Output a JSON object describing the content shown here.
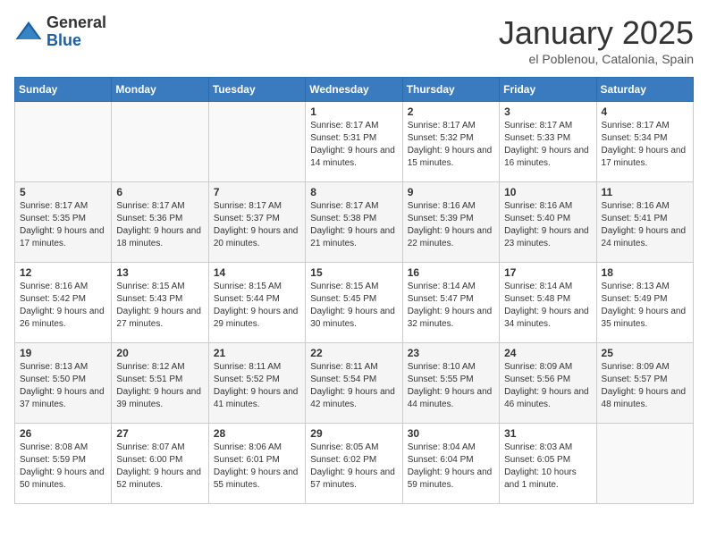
{
  "logo": {
    "general": "General",
    "blue": "Blue"
  },
  "title": "January 2025",
  "subtitle": "el Poblenou, Catalonia, Spain",
  "days_of_week": [
    "Sunday",
    "Monday",
    "Tuesday",
    "Wednesday",
    "Thursday",
    "Friday",
    "Saturday"
  ],
  "weeks": [
    [
      {
        "day": "",
        "sunrise": "",
        "sunset": "",
        "daylight": ""
      },
      {
        "day": "",
        "sunrise": "",
        "sunset": "",
        "daylight": ""
      },
      {
        "day": "",
        "sunrise": "",
        "sunset": "",
        "daylight": ""
      },
      {
        "day": "1",
        "sunrise": "Sunrise: 8:17 AM",
        "sunset": "Sunset: 5:31 PM",
        "daylight": "Daylight: 9 hours and 14 minutes."
      },
      {
        "day": "2",
        "sunrise": "Sunrise: 8:17 AM",
        "sunset": "Sunset: 5:32 PM",
        "daylight": "Daylight: 9 hours and 15 minutes."
      },
      {
        "day": "3",
        "sunrise": "Sunrise: 8:17 AM",
        "sunset": "Sunset: 5:33 PM",
        "daylight": "Daylight: 9 hours and 16 minutes."
      },
      {
        "day": "4",
        "sunrise": "Sunrise: 8:17 AM",
        "sunset": "Sunset: 5:34 PM",
        "daylight": "Daylight: 9 hours and 17 minutes."
      }
    ],
    [
      {
        "day": "5",
        "sunrise": "Sunrise: 8:17 AM",
        "sunset": "Sunset: 5:35 PM",
        "daylight": "Daylight: 9 hours and 17 minutes."
      },
      {
        "day": "6",
        "sunrise": "Sunrise: 8:17 AM",
        "sunset": "Sunset: 5:36 PM",
        "daylight": "Daylight: 9 hours and 18 minutes."
      },
      {
        "day": "7",
        "sunrise": "Sunrise: 8:17 AM",
        "sunset": "Sunset: 5:37 PM",
        "daylight": "Daylight: 9 hours and 20 minutes."
      },
      {
        "day": "8",
        "sunrise": "Sunrise: 8:17 AM",
        "sunset": "Sunset: 5:38 PM",
        "daylight": "Daylight: 9 hours and 21 minutes."
      },
      {
        "day": "9",
        "sunrise": "Sunrise: 8:16 AM",
        "sunset": "Sunset: 5:39 PM",
        "daylight": "Daylight: 9 hours and 22 minutes."
      },
      {
        "day": "10",
        "sunrise": "Sunrise: 8:16 AM",
        "sunset": "Sunset: 5:40 PM",
        "daylight": "Daylight: 9 hours and 23 minutes."
      },
      {
        "day": "11",
        "sunrise": "Sunrise: 8:16 AM",
        "sunset": "Sunset: 5:41 PM",
        "daylight": "Daylight: 9 hours and 24 minutes."
      }
    ],
    [
      {
        "day": "12",
        "sunrise": "Sunrise: 8:16 AM",
        "sunset": "Sunset: 5:42 PM",
        "daylight": "Daylight: 9 hours and 26 minutes."
      },
      {
        "day": "13",
        "sunrise": "Sunrise: 8:15 AM",
        "sunset": "Sunset: 5:43 PM",
        "daylight": "Daylight: 9 hours and 27 minutes."
      },
      {
        "day": "14",
        "sunrise": "Sunrise: 8:15 AM",
        "sunset": "Sunset: 5:44 PM",
        "daylight": "Daylight: 9 hours and 29 minutes."
      },
      {
        "day": "15",
        "sunrise": "Sunrise: 8:15 AM",
        "sunset": "Sunset: 5:45 PM",
        "daylight": "Daylight: 9 hours and 30 minutes."
      },
      {
        "day": "16",
        "sunrise": "Sunrise: 8:14 AM",
        "sunset": "Sunset: 5:47 PM",
        "daylight": "Daylight: 9 hours and 32 minutes."
      },
      {
        "day": "17",
        "sunrise": "Sunrise: 8:14 AM",
        "sunset": "Sunset: 5:48 PM",
        "daylight": "Daylight: 9 hours and 34 minutes."
      },
      {
        "day": "18",
        "sunrise": "Sunrise: 8:13 AM",
        "sunset": "Sunset: 5:49 PM",
        "daylight": "Daylight: 9 hours and 35 minutes."
      }
    ],
    [
      {
        "day": "19",
        "sunrise": "Sunrise: 8:13 AM",
        "sunset": "Sunset: 5:50 PM",
        "daylight": "Daylight: 9 hours and 37 minutes."
      },
      {
        "day": "20",
        "sunrise": "Sunrise: 8:12 AM",
        "sunset": "Sunset: 5:51 PM",
        "daylight": "Daylight: 9 hours and 39 minutes."
      },
      {
        "day": "21",
        "sunrise": "Sunrise: 8:11 AM",
        "sunset": "Sunset: 5:52 PM",
        "daylight": "Daylight: 9 hours and 41 minutes."
      },
      {
        "day": "22",
        "sunrise": "Sunrise: 8:11 AM",
        "sunset": "Sunset: 5:54 PM",
        "daylight": "Daylight: 9 hours and 42 minutes."
      },
      {
        "day": "23",
        "sunrise": "Sunrise: 8:10 AM",
        "sunset": "Sunset: 5:55 PM",
        "daylight": "Daylight: 9 hours and 44 minutes."
      },
      {
        "day": "24",
        "sunrise": "Sunrise: 8:09 AM",
        "sunset": "Sunset: 5:56 PM",
        "daylight": "Daylight: 9 hours and 46 minutes."
      },
      {
        "day": "25",
        "sunrise": "Sunrise: 8:09 AM",
        "sunset": "Sunset: 5:57 PM",
        "daylight": "Daylight: 9 hours and 48 minutes."
      }
    ],
    [
      {
        "day": "26",
        "sunrise": "Sunrise: 8:08 AM",
        "sunset": "Sunset: 5:59 PM",
        "daylight": "Daylight: 9 hours and 50 minutes."
      },
      {
        "day": "27",
        "sunrise": "Sunrise: 8:07 AM",
        "sunset": "Sunset: 6:00 PM",
        "daylight": "Daylight: 9 hours and 52 minutes."
      },
      {
        "day": "28",
        "sunrise": "Sunrise: 8:06 AM",
        "sunset": "Sunset: 6:01 PM",
        "daylight": "Daylight: 9 hours and 55 minutes."
      },
      {
        "day": "29",
        "sunrise": "Sunrise: 8:05 AM",
        "sunset": "Sunset: 6:02 PM",
        "daylight": "Daylight: 9 hours and 57 minutes."
      },
      {
        "day": "30",
        "sunrise": "Sunrise: 8:04 AM",
        "sunset": "Sunset: 6:04 PM",
        "daylight": "Daylight: 9 hours and 59 minutes."
      },
      {
        "day": "31",
        "sunrise": "Sunrise: 8:03 AM",
        "sunset": "Sunset: 6:05 PM",
        "daylight": "Daylight: 10 hours and 1 minute."
      },
      {
        "day": "",
        "sunrise": "",
        "sunset": "",
        "daylight": ""
      }
    ]
  ]
}
